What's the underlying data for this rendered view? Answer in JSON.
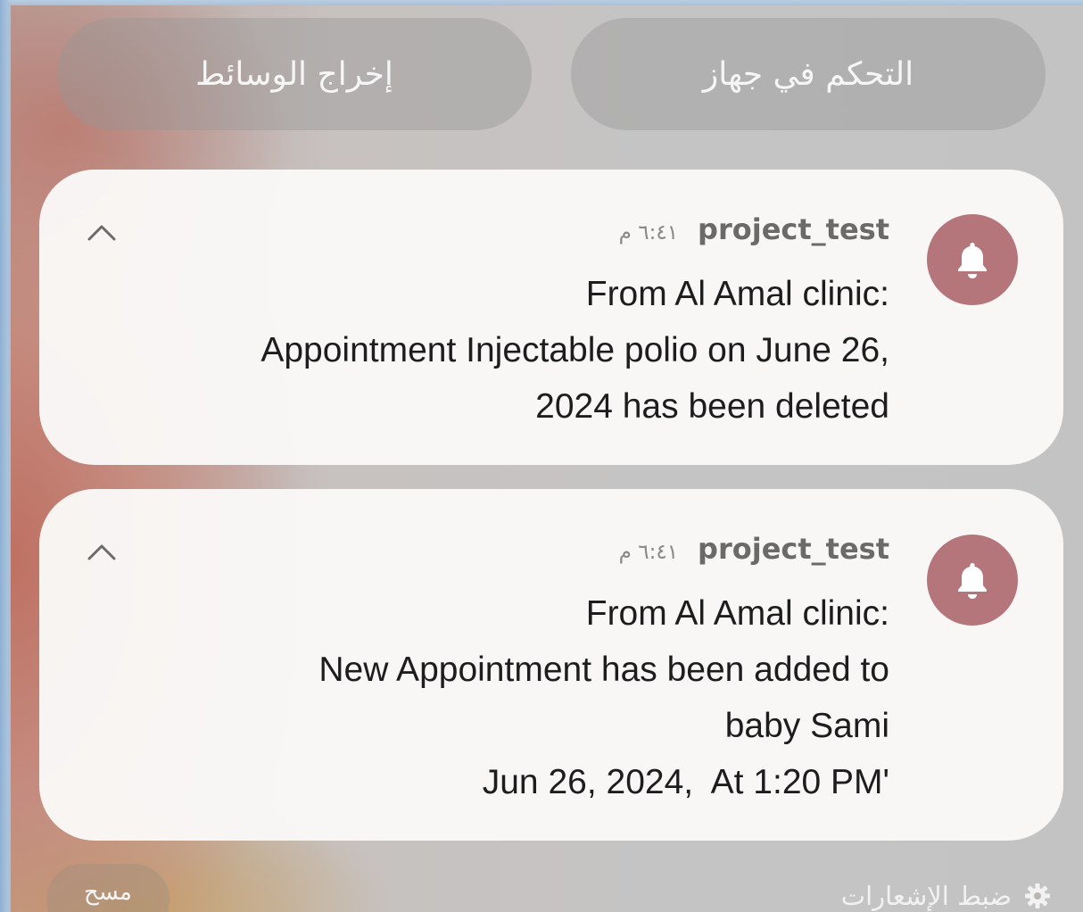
{
  "quick_buttons": {
    "device_control_label": "التحكم في جهاز",
    "media_output_label": "إخراج الوسائط"
  },
  "notifications": [
    {
      "app_name": "project_test",
      "time": "٦:٤١ م",
      "icon": "bell-icon",
      "lines": [
        "From Al Amal clinic:",
        "Appointment Injectable polio on June 26,",
        "2024 has been deleted"
      ]
    },
    {
      "app_name": "project_test",
      "time": "٦:٤١ م",
      "icon": "bell-icon",
      "lines": [
        "From Al Amal clinic:",
        "New Appointment has been added to",
        "baby Sami",
        "Jun 26, 2024,  At 1:20 PM'"
      ]
    }
  ],
  "footer": {
    "clear_label": "مسح",
    "settings_label": "ضبط الإشعارات",
    "settings_icon": "gear-icon"
  },
  "colors": {
    "bell_bg": "#b5767b",
    "card_bg": "#faf9f8"
  }
}
